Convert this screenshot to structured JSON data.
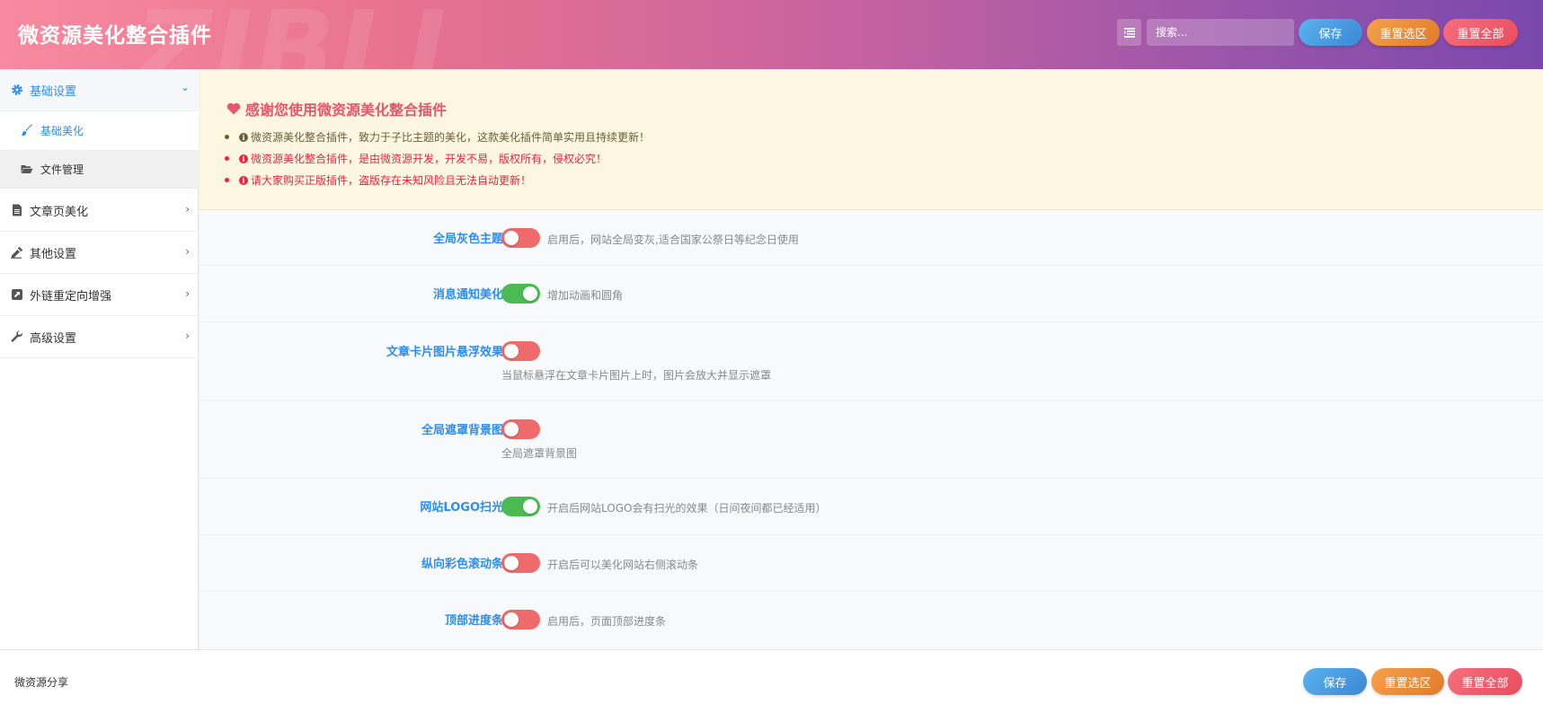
{
  "header": {
    "title": "微资源美化整合插件",
    "watermark": "ZIBLL",
    "search_placeholder": "搜索...",
    "menu_icon": "list-icon",
    "save_label": "保存",
    "reset_section_label": "重置选区",
    "reset_all_label": "重置全部"
  },
  "sidebar": {
    "items": [
      {
        "label": "基础设置",
        "icon": "gear-icon",
        "expanded": true,
        "active": true
      },
      {
        "label": "基础美化",
        "icon": "brush-icon",
        "sub": true,
        "active": true
      },
      {
        "label": "文件管理",
        "icon": "folder-open-icon",
        "sub": true
      },
      {
        "label": "文章页美化",
        "icon": "file-text-icon"
      },
      {
        "label": "其他设置",
        "icon": "eyedropper-icon"
      },
      {
        "label": "外链重定向增强",
        "icon": "external-link-icon"
      },
      {
        "label": "高级设置",
        "icon": "wrench-icon"
      }
    ]
  },
  "notice": {
    "title": "感谢您使用微资源美化整合插件",
    "bullets": [
      {
        "text": "微资源美化整合插件，致力于子比主题的美化，这款美化插件简单实用且持续更新！",
        "color": "#6b5d3a"
      },
      {
        "text": "微资源美化整合插件，是由微资源开发，开发不易，版权所有，侵权必究！",
        "color": "#e8253f"
      },
      {
        "text": "请大家购买正版插件，盗版存在未知风险且无法自动更新！",
        "color": "#e8253f"
      }
    ]
  },
  "settings": [
    {
      "label": "全局灰色主题",
      "enabled": false,
      "desc": "启用后，网站全局变灰,适合国家公祭日等纪念日使用"
    },
    {
      "label": "消息通知美化",
      "enabled": true,
      "desc": "增加动画和圆角"
    },
    {
      "label": "文章卡片图片悬浮效果",
      "enabled": false,
      "desc": "当鼠标悬浮在文章卡片图片上时，图片会放大并显示遮罩"
    },
    {
      "label": "全局遮罩背景图",
      "enabled": false,
      "desc": "全局遮罩背景图"
    },
    {
      "label": "网站LOGO扫光",
      "enabled": true,
      "desc": "开启后网站LOGO会有扫光的效果（日间夜间都已经适用）"
    },
    {
      "label": "纵向彩色滚动条",
      "enabled": false,
      "desc": "开启后可以美化网站右侧滚动条"
    },
    {
      "label": "顶部进度条",
      "enabled": false,
      "desc": "启用后，页面顶部进度条"
    }
  ],
  "footer": {
    "text": "微资源分享",
    "save_label": "保存",
    "reset_section_label": "重置选区",
    "reset_all_label": "重置全部"
  },
  "colors": {
    "accent": "#2c8ef0",
    "toggle_on": "#4cba53",
    "toggle_off": "#ef6b6b",
    "notice_title": "#e8566c"
  }
}
